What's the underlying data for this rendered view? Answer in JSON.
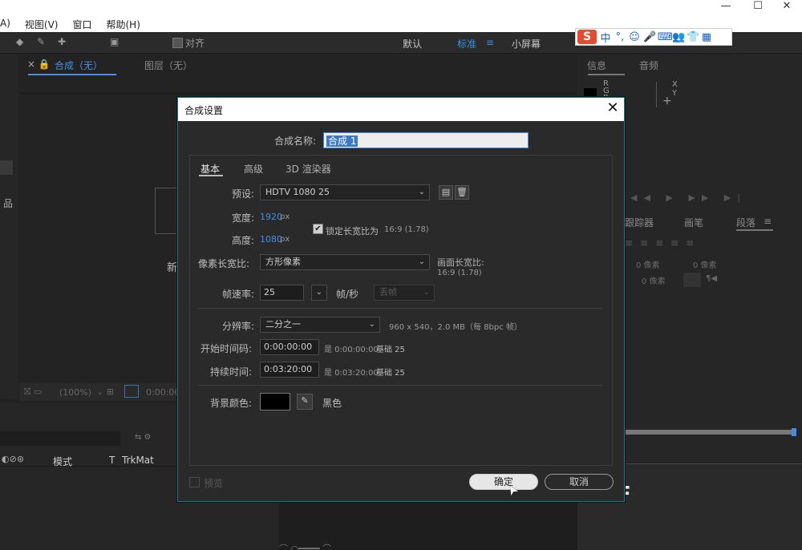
{
  "menubar": {
    "items": [
      "A)",
      "视图(V)",
      "窗口",
      "帮助(H)"
    ]
  },
  "window_controls": {
    "minimize": "—",
    "maximize": "☐",
    "close": "✕"
  },
  "toolbar": {
    "align_label": "对齐",
    "workspaces": [
      "默认",
      "标准",
      "小屏幕"
    ],
    "active_workspace": "标准",
    "menu_glyph": "≡"
  },
  "ime": {
    "logo": "S",
    "items": [
      "中",
      "°,",
      "☺",
      "🎤",
      "⌨",
      "👥",
      "👕",
      "▦"
    ]
  },
  "comp_panel": {
    "tab_comp": "合成（无）",
    "tab_layer": "图层（无）",
    "new_label": "新",
    "zoom": "(100%)",
    "timecode": "0:00:00"
  },
  "right_panel": {
    "tab_info": "信息",
    "tab_audio": "音频",
    "rgb": [
      "R",
      "G",
      "B"
    ],
    "xy": [
      "X",
      "Y"
    ],
    "tab_tracker": "跟踪器",
    "tab_brush": "画笔",
    "tab_paragraph": "段落",
    "indent_1": "0 像素",
    "indent_2": "0 像素",
    "indent_3": "0 像素",
    "indent_4": "0 像素",
    "indent_5": "0 像素"
  },
  "timeline": {
    "col_mode": "模式",
    "col_t": "T",
    "col_trkmat": "TrkMat"
  },
  "dialog": {
    "title": "合成设置",
    "close_glyph": "✕",
    "name_label": "合成名称:",
    "name_value": "合成 1",
    "tabs": [
      "基本",
      "高级",
      "3D 渲染器"
    ],
    "preset_label": "预设:",
    "preset_value": "HDTV 1080 25",
    "width_label": "宽度:",
    "width_value": "1920",
    "height_label": "高度:",
    "height_value": "1080",
    "px_unit": "px",
    "lock_aspect_label": "锁定长宽比为",
    "lock_aspect_value": "16:9 (1.78)",
    "lock_aspect_checked": true,
    "pixel_aspect_label": "像素长宽比:",
    "pixel_aspect_value": "方形像素",
    "frame_aspect_label": "画面长宽比:",
    "frame_aspect_value": "16:9 (1.78)",
    "fps_label": "帧速率:",
    "fps_value": "25",
    "fps_unit": "帧/秒",
    "drop_frame_value": "丢帧",
    "resolution_label": "分辨率:",
    "resolution_value": "二分之一",
    "resolution_info": "960 x 540，2.0 MB（每 8bpc 帧）",
    "start_tc_label": "开始时间码:",
    "start_tc_value": "0:00:00:00",
    "start_tc_info": "是 0:00:00:00",
    "start_tc_base": "基础 25",
    "duration_label": "持续时间:",
    "duration_value": "0:03:20:00",
    "duration_info": "是 0:03:20:00",
    "duration_base": "基础 25",
    "bg_color_label": "背景颜色:",
    "bg_color_value": "#000000",
    "bg_color_name": "黑色",
    "preview_label": "预览",
    "ok_label": "确定",
    "cancel_label": "取消"
  },
  "colors": {
    "accent": "#3f8ee8",
    "dialog_border": "#0f7f8f"
  }
}
